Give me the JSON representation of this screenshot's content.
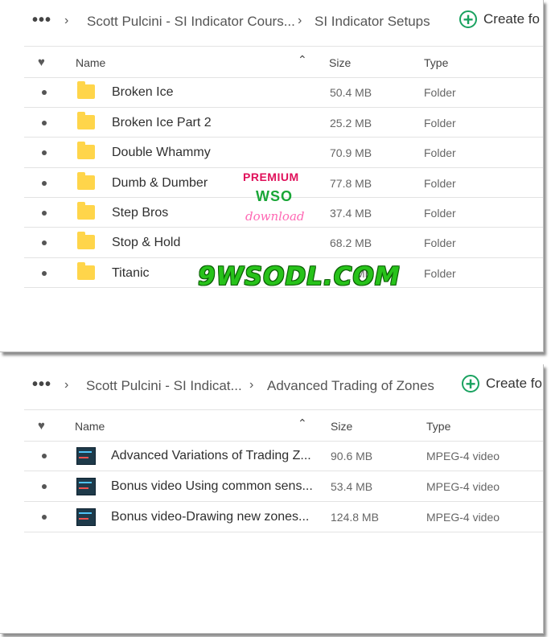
{
  "panels": [
    {
      "breadcrumb": {
        "more": "•••",
        "crumb1": "Scott Pulcini - SI Indicator Cours...",
        "crumb2": "SI Indicator Setups",
        "sep": "›"
      },
      "create_label": "Create fo",
      "columns": {
        "name": "Name",
        "size": "Size",
        "type": "Type"
      },
      "rows": [
        {
          "name": "Broken Ice",
          "size": "50.4 MB",
          "type": "Folder"
        },
        {
          "name": "Broken Ice Part 2",
          "size": "25.2 MB",
          "type": "Folder"
        },
        {
          "name": "Double Whammy",
          "size": "70.9 MB",
          "type": "Folder"
        },
        {
          "name": "Dumb & Dumber",
          "size": "77.8 MB",
          "type": "Folder"
        },
        {
          "name": "Step Bros",
          "size": "37.4 MB",
          "type": "Folder"
        },
        {
          "name": "Stop & Hold",
          "size": "68.2 MB",
          "type": "Folder"
        },
        {
          "name": "Titanic",
          "size": "MB",
          "type": "Folder"
        }
      ]
    },
    {
      "breadcrumb": {
        "more": "•••",
        "crumb1": "Scott Pulcini - SI Indicat...",
        "crumb2": "Advanced Trading of Zones",
        "sep": "›"
      },
      "create_label": "Create fo",
      "columns": {
        "name": "Name",
        "size": "Size",
        "type": "Type"
      },
      "rows": [
        {
          "name": "Advanced Variations of Trading Z...",
          "size": "90.6 MB",
          "type": "MPEG-4 video"
        },
        {
          "name": "Bonus video Using common sens...",
          "size": "53.4 MB",
          "type": "MPEG-4 video"
        },
        {
          "name": "Bonus video-Drawing new zones...",
          "size": "124.8 MB",
          "type": "MPEG-4 video"
        }
      ]
    }
  ],
  "watermark": {
    "premium": "PREMIUM",
    "wso": "WSO",
    "download": "download",
    "site": "9WSODL.COM"
  },
  "icons": {
    "more": "more-dots-icon",
    "chevron": "chevron-right-icon",
    "create": "plus-circle-icon",
    "favorite": "heart-icon",
    "sort": "caret-up-icon",
    "folder": "folder-icon",
    "video": "video-thumbnail-icon"
  },
  "colors": {
    "accent": "#1aa260",
    "folder": "#ffd54a"
  }
}
